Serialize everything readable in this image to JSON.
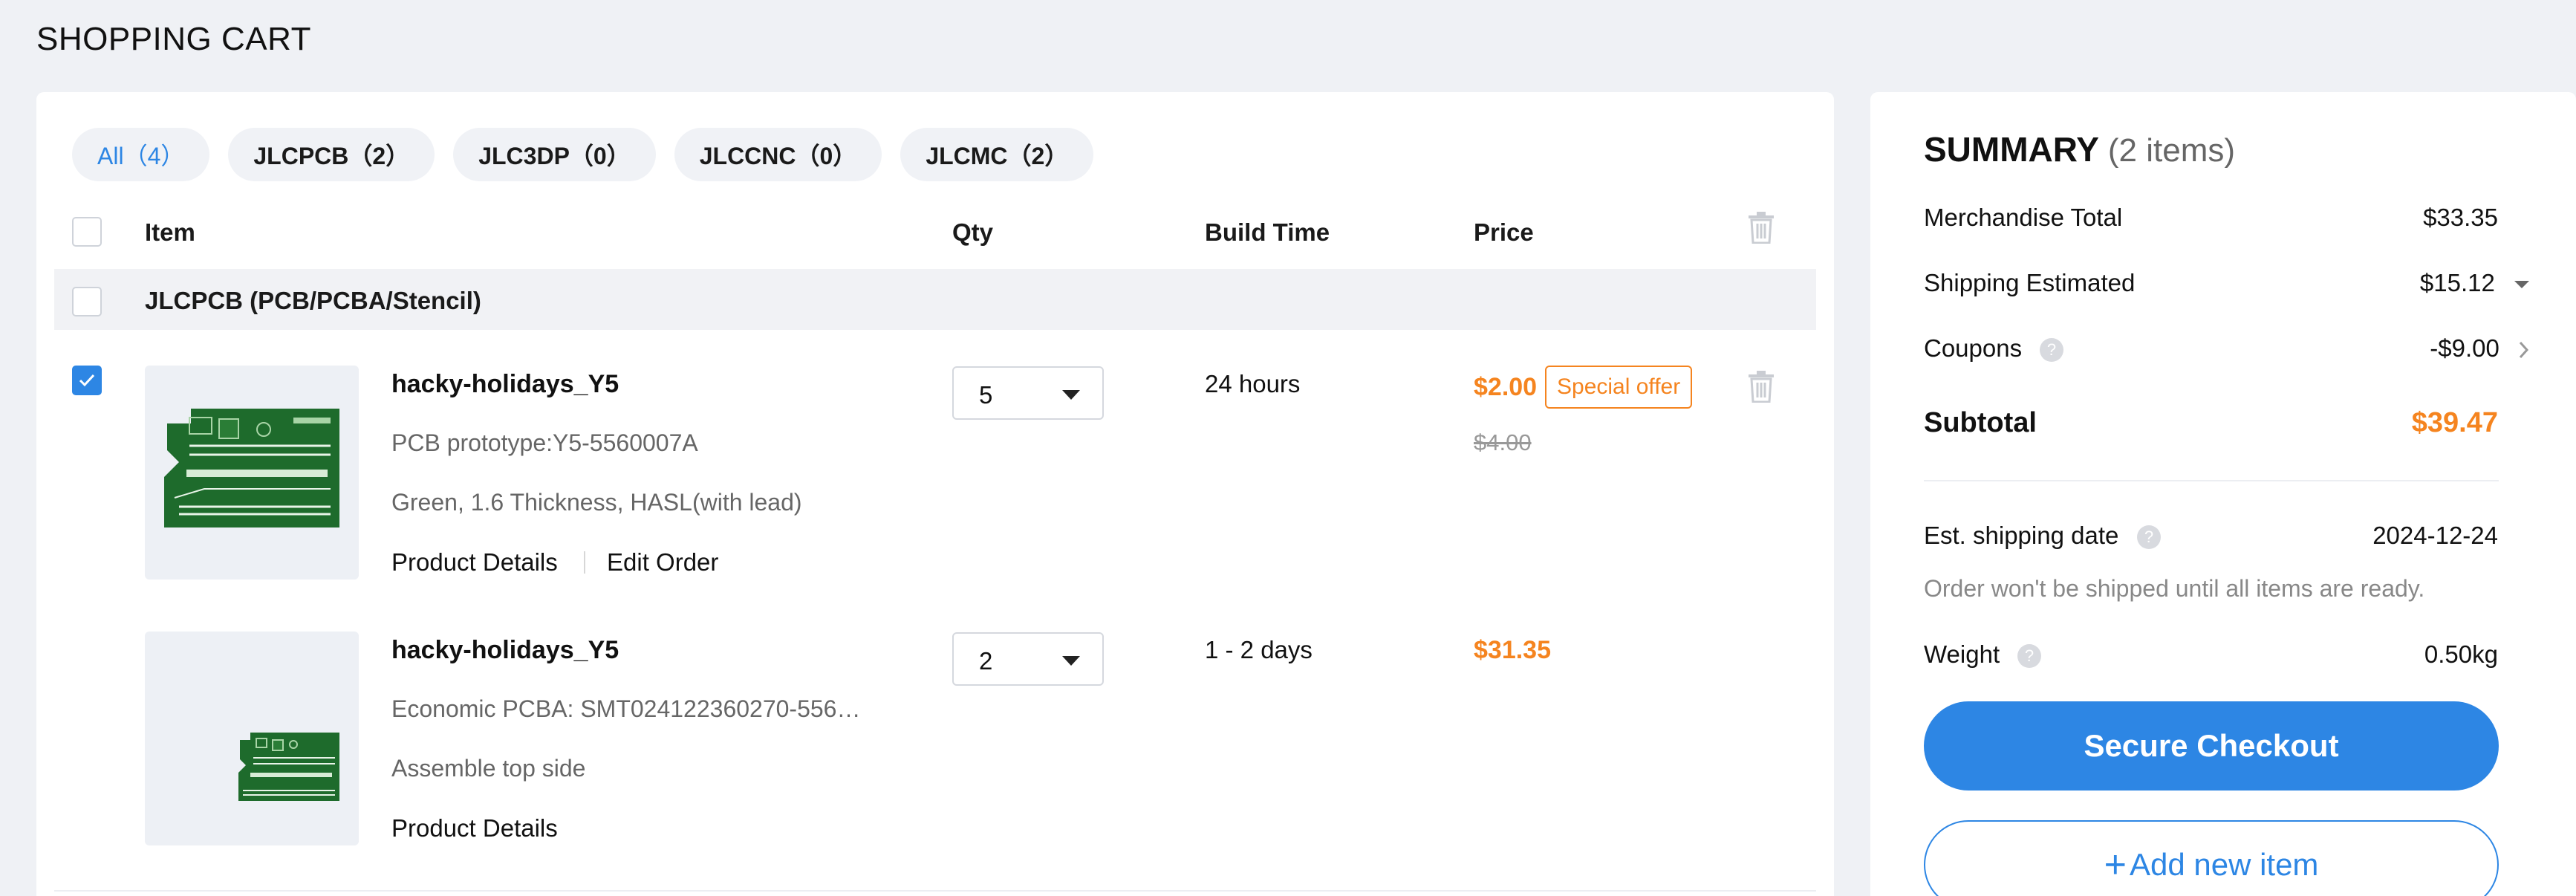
{
  "page_title": "SHOPPING CART",
  "tabs": [
    {
      "label": "All（4）",
      "active": true
    },
    {
      "label": "JLCPCB（2）",
      "active": false
    },
    {
      "label": "JLC3DP（0）",
      "active": false
    },
    {
      "label": "JLCCNC（0）",
      "active": false
    },
    {
      "label": "JLCMC（2）",
      "active": false
    }
  ],
  "columns": {
    "item": "Item",
    "qty": "Qty",
    "build_time": "Build Time",
    "price": "Price"
  },
  "group": {
    "label": "JLCPCB (PCB/PCBA/Stencil)"
  },
  "items": [
    {
      "checked": true,
      "name": "hacky-holidays_Y5",
      "meta1": "PCB prototype:Y5-5560007A",
      "meta2": "Green, 1.6 Thickness, HASL(with lead)",
      "link1": "Product Details",
      "link2": "Edit Order",
      "qty": "5",
      "build_time": "24 hours",
      "price": "$2.00",
      "badge": "Special offer",
      "price_old": "$4.00"
    },
    {
      "checked": false,
      "name": "hacky-holidays_Y5",
      "meta1": "Economic PCBA: SMT024122360270-556…",
      "meta2": "Assemble top side",
      "link1": "Product Details",
      "qty": "2",
      "build_time": "1 - 2 days",
      "price": "$31.35"
    }
  ],
  "summary": {
    "title": "SUMMARY",
    "count": "(2 items)",
    "merch_label": "Merchandise Total",
    "merch_value": "$33.35",
    "shipping_label": "Shipping Estimated",
    "shipping_value": "$15.12",
    "coupons_label": "Coupons",
    "coupons_value": "-$9.00",
    "subtotal_label": "Subtotal",
    "subtotal_value": "$39.47",
    "ship_date_label": "Est. shipping date",
    "ship_date_value": "2024-12-24",
    "note": "Order won't be shipped until all items are ready.",
    "weight_label": "Weight",
    "weight_value": "0.50kg",
    "checkout_label": "Secure Checkout",
    "add_item_label": "Add new item"
  },
  "colors": {
    "accent": "#2d86e4",
    "price": "#f5841f",
    "pcb_green": "#1e6b2c"
  },
  "icons": [
    "checkbox-icon",
    "trash-icon",
    "caret-down-icon",
    "help-icon",
    "chevron-right-icon",
    "plus-icon"
  ]
}
